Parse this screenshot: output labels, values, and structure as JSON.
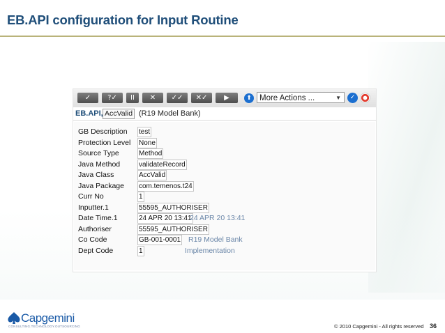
{
  "slide": {
    "title": "EB.API configuration for Input Routine",
    "footer_copyright": "© 2010 Capgemini - All rights reserved",
    "page_number": "36",
    "logo_text": "Capgemini",
    "logo_tagline": "CONSULTING.TECHNOLOGY.OUTSOURCING"
  },
  "toolbar": {
    "buttons": [
      {
        "icon": "validate-icon",
        "glyph": "✓"
      },
      {
        "icon": "hold-icon",
        "glyph": "?✓"
      },
      {
        "icon": "pause-icon",
        "glyph": "II"
      },
      {
        "icon": "delete-icon",
        "glyph": "✕"
      },
      {
        "icon": "authorise-icon",
        "glyph": "✓✓"
      },
      {
        "icon": "reverse-icon",
        "glyph": "✕✓"
      },
      {
        "icon": "next-icon",
        "glyph": "▶"
      }
    ],
    "more_actions_label": "More Actions ...",
    "dropdown_arrow": "▼"
  },
  "record": {
    "application": "EB.API,",
    "record_id": "AccValid",
    "company": "(R19 Model Bank)"
  },
  "fields": [
    {
      "label": "GB Description",
      "value": "test",
      "extra": ""
    },
    {
      "label": "Protection Level",
      "value": "None",
      "extra": ""
    },
    {
      "label": "Source Type",
      "value": "Method",
      "extra": ""
    },
    {
      "label": "Java Method",
      "value": "validateRecord",
      "extra": ""
    },
    {
      "label": "Java Class",
      "value": "AccValid",
      "extra": ""
    },
    {
      "label": "Java Package",
      "value": "com.temenos.t24",
      "extra": ""
    },
    {
      "label": "Curr No",
      "value": "1",
      "extra": ""
    },
    {
      "label": "Inputter.1",
      "value": "55595_AUTHORISER",
      "extra": ""
    },
    {
      "label": "Date Time.1",
      "value": "24 APR 20 13:41",
      "extra": "24 APR 20 13:41"
    },
    {
      "label": "Authoriser",
      "value": "55595_AUTHORISER",
      "extra": ""
    },
    {
      "label": "Co Code",
      "value": "GB-001-0001",
      "extra": "R19 Model Bank"
    },
    {
      "label": "Dept Code",
      "value": "1",
      "extra": "Implementation"
    }
  ]
}
